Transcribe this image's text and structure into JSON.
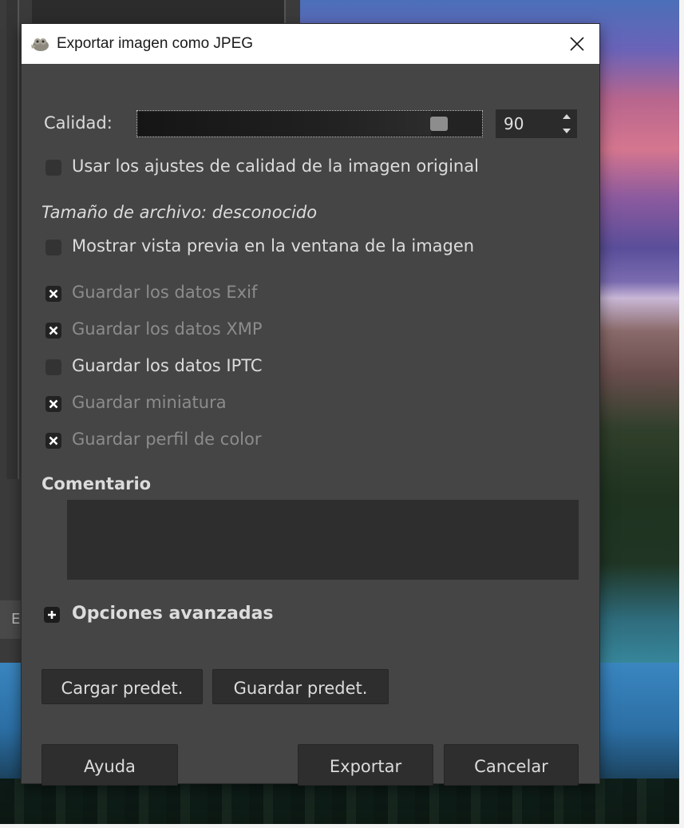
{
  "background": {
    "left_strip_label": "E"
  },
  "dialog": {
    "title": "Exportar imagen como JPEG",
    "quality": {
      "label": "Calidad:",
      "value": "90",
      "fraction": 0.9
    },
    "options": {
      "use_original_quality": "Usar los ajustes de calidad de la imagen original",
      "file_size": "Tamaño de archivo: desconocido",
      "show_preview": "Mostrar vista previa en la ventana de la imagen",
      "save_exif": "Guardar los datos Exif",
      "save_xmp": "Guardar los datos XMP",
      "save_iptc": "Guardar los datos IPTC",
      "save_thumbnail": "Guardar miniatura",
      "save_color_profile": "Guardar perfil de color"
    },
    "comment_label": "Comentario",
    "comment_value": "",
    "advanced_label": "Opciones avanzadas",
    "buttons": {
      "load_defaults": "Cargar predet.",
      "save_defaults": "Guardar predet.",
      "help": "Ayuda",
      "export": "Exportar",
      "cancel": "Cancelar"
    }
  }
}
